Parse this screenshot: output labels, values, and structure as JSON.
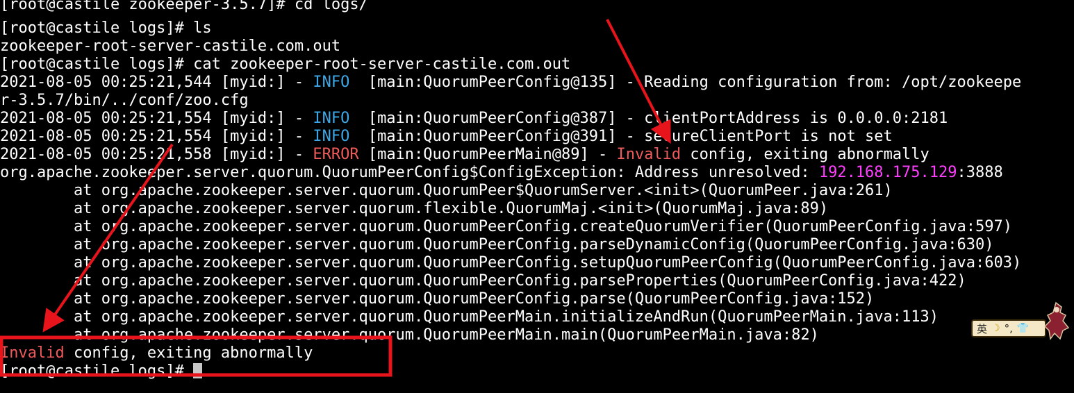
{
  "terminal": {
    "lines": {
      "l0": {
        "text": "[root@castile zookeeper-3.5.7]# cd logs/"
      },
      "l1": {
        "text": "[root@castile logs]# ls"
      },
      "l2": {
        "text": "zookeeper-root-server-castile.com.out"
      },
      "l3": {
        "text": "[root@castile logs]# cat zookeeper-root-server-castile.com.out"
      },
      "l4": {
        "prefix": "2021-08-05 00:25:21,544 [myid:] - ",
        "level": "INFO",
        "rest": "  [main:QuorumPeerConfig@135] - Reading configuration from: /opt/zookeepe"
      },
      "l5": {
        "text": "r-3.5.7/bin/../conf/zoo.cfg"
      },
      "l6": {
        "prefix": "2021-08-05 00:25:21,554 [myid:] - ",
        "level": "INFO",
        "rest": "  [main:QuorumPeerConfig@387] - clientPortAddress is 0.0.0.0:2181"
      },
      "l7": {
        "prefix": "2021-08-05 00:25:21,554 [myid:] - ",
        "level": "INFO",
        "rest": "  [main:QuorumPeerConfig@391] - secureClientPort is not set"
      },
      "l8": {
        "prefix": "2021-08-05 00:25:21,558 [myid:] - ",
        "level": "ERROR",
        "mid": " [main:QuorumPeerMain@89] - ",
        "highlight": "Invalid",
        "rest": " config, exiting abnormally"
      },
      "l9": {
        "prefix": "org.apache.zookeeper.server.quorum.QuorumPeerConfig$ConfigException: Address unresolved: ",
        "ip": "192.168.175.129",
        "rest": ":3888"
      },
      "l10": {
        "text": "        at org.apache.zookeeper.server.quorum.QuorumPeer$QuorumServer.<init>(QuorumPeer.java:261)"
      },
      "l11": {
        "text": "        at org.apache.zookeeper.server.quorum.flexible.QuorumMaj.<init>(QuorumMaj.java:89)"
      },
      "l12": {
        "text": "        at org.apache.zookeeper.server.quorum.QuorumPeerConfig.createQuorumVerifier(QuorumPeerConfig.java:597)"
      },
      "l13": {
        "text": "        at org.apache.zookeeper.server.quorum.QuorumPeerConfig.parseDynamicConfig(QuorumPeerConfig.java:630)"
      },
      "l14": {
        "text": "        at org.apache.zookeeper.server.quorum.QuorumPeerConfig.setupQuorumPeerConfig(QuorumPeerConfig.java:603)"
      },
      "l15": {
        "text": "        at org.apache.zookeeper.server.quorum.QuorumPeerConfig.parseProperties(QuorumPeerConfig.java:422)"
      },
      "l16": {
        "text": "        at org.apache.zookeeper.server.quorum.QuorumPeerConfig.parse(QuorumPeerConfig.java:152)"
      },
      "l17": {
        "text": "        at org.apache.zookeeper.server.quorum.QuorumPeerMain.initializeAndRun(QuorumPeerMain.java:113)"
      },
      "l18": {
        "text": "        at org.apache.zookeeper.server.quorum.QuorumPeerMain.main(QuorumPeerMain.java:82)"
      },
      "l19": {
        "highlight": "Invalid",
        "rest": " config, exiting abnormally"
      },
      "l20": {
        "text": "[root@castile logs]# "
      }
    }
  },
  "ime": {
    "mode_char": "英",
    "moon_glyph": "☽",
    "punct_glyph": "°,",
    "shirt_glyph": "👕"
  },
  "colors": {
    "background": "#000000",
    "text": "#ffffff",
    "info": "#3ea7e6",
    "error": "#ef5b5b",
    "ip_highlight": "#ff3fff",
    "annotation_red": "#e8141b"
  }
}
